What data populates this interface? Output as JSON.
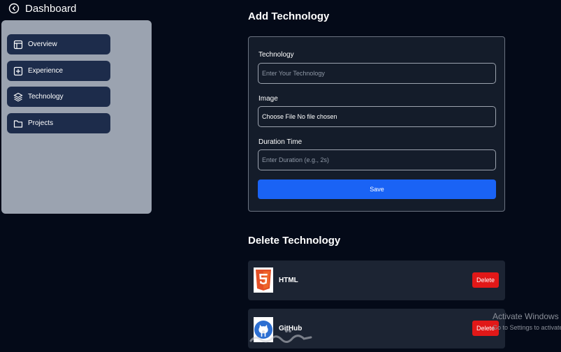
{
  "header": {
    "title": "Dashboard",
    "back_icon": "arrow-left-circle-icon"
  },
  "sidebar": {
    "items": [
      {
        "label": "Overview",
        "icon": "layout-icon"
      },
      {
        "label": "Experience",
        "icon": "plus-square-icon"
      },
      {
        "label": "Technology",
        "icon": "layers-icon"
      },
      {
        "label": "Projects",
        "icon": "folder-icon"
      }
    ]
  },
  "add_technology": {
    "title": "Add Technology",
    "technology_label": "Technology",
    "technology_placeholder": "Enter Your Technology",
    "image_label": "Image",
    "image_value": "Choose File No file chosen",
    "duration_label": "Duration Time",
    "duration_placeholder": "Enter Duration (e.g., 2s)",
    "save_label": "Save"
  },
  "delete_technology": {
    "title": "Delete Technology",
    "items": [
      {
        "name": "HTML",
        "icon": "html5-logo",
        "delete_label": "Delete"
      },
      {
        "name": "GitHub",
        "icon": "github-logo",
        "delete_label": "Delete"
      }
    ]
  },
  "watermark": {
    "title": "Activate Windows",
    "subtitle": "Go to Settings to activate Windows."
  },
  "site_mark": {
    "text": "خمسات"
  },
  "colors": {
    "background": "#040a18",
    "sidebar": "#9ba3b0",
    "nav_item": "#1d2c4b",
    "card": "#141c2a",
    "primary": "#1a63f5",
    "danger": "#e11818",
    "html_orange": "#e34f26"
  }
}
